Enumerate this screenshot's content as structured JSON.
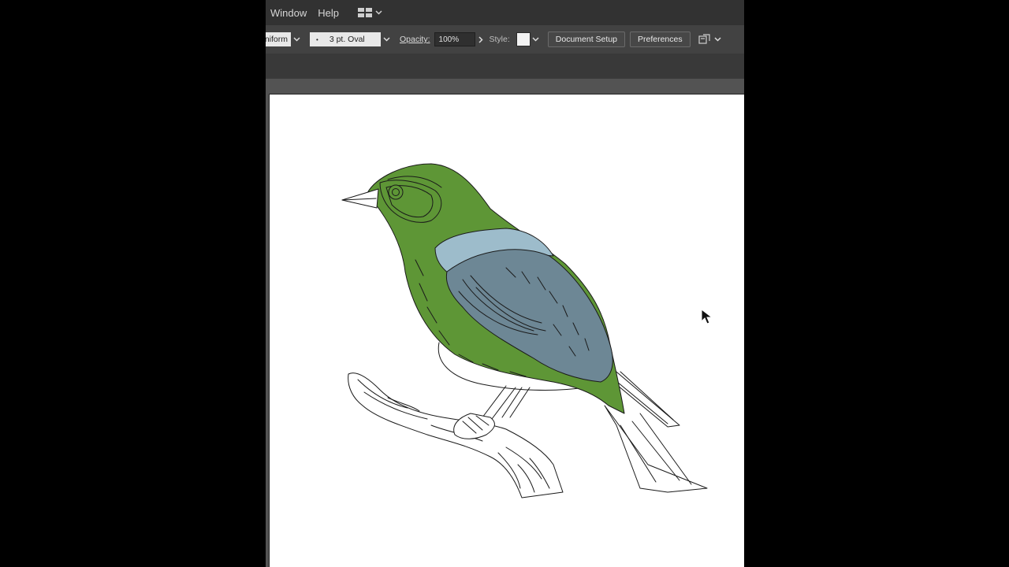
{
  "menubar": {
    "items": [
      "Window",
      "Help"
    ],
    "workspace_icon": "workspace-layout-icon"
  },
  "controlbar": {
    "stroke_profile": "Uniform",
    "brush_dot": "•",
    "brush_name": "3 pt. Oval",
    "opacity_label": "Opacity:",
    "opacity_value": "100%",
    "style_label": "Style:",
    "document_setup": "Document Setup",
    "preferences": "Preferences",
    "arrange_icon": "arrange-documents-icon"
  },
  "artwork": {
    "subject": "bird-on-branch-illustration",
    "colors": {
      "green": "#5e9636",
      "slate": "#6d8795",
      "light_blue": "#9dbccb",
      "outline": "#1a1a1a"
    }
  }
}
